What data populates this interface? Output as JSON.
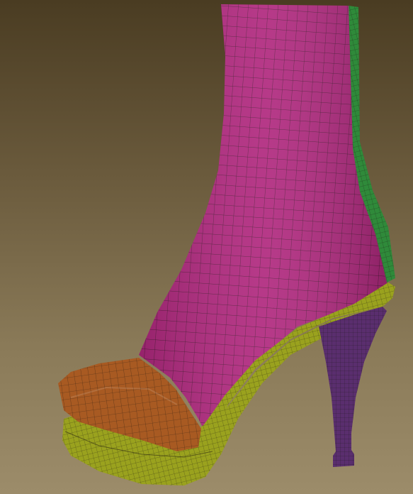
{
  "scene": {
    "subject": "boot-wireframe-render",
    "colors": {
      "background_top": "#4a3c22",
      "background_bottom": "#9c8c6a",
      "upper": "#b0287e",
      "back_strip": "#2f8a3a",
      "sole": "#9aa21e",
      "toe_cap": "#a85a22",
      "heel": "#5a2e6e",
      "wire": "#1a1410"
    }
  }
}
